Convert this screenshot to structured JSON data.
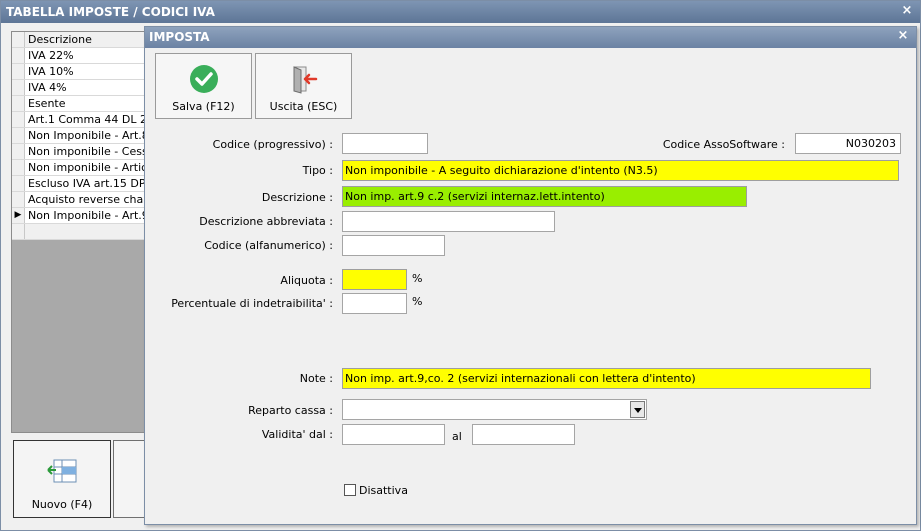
{
  "outer": {
    "title": "TABELLA IMPOSTE / CODICI IVA",
    "close_label": "×",
    "grid": {
      "header": "Descrizione",
      "rows": [
        "IVA 22%",
        "IVA 10%",
        "IVA 4%",
        "Esente",
        "Art.1 Comma 44 DL 27/1",
        "Non Imponibile - Art.8 Co",
        "Non imponibile - Cessioni",
        "Non imponibile - Articolo",
        "Escluso IVA art.15 DPR 6",
        "Acquisto reverse charge",
        "Non Imponibile - Art.9 Co"
      ],
      "current_row_marker": "▶"
    },
    "new_button": "Nuovo (F4)"
  },
  "dialog": {
    "title": "IMPOSTA",
    "close_label": "×",
    "save_button": "Salva (F12)",
    "exit_button": "Uscita (ESC)",
    "labels": {
      "codice_progressivo": "Codice (progressivo) :",
      "codice_assosoftware": "Codice AssoSoftware :",
      "tipo": "Tipo :",
      "descrizione": "Descrizione :",
      "descrizione_abbreviata": "Descrizione abbreviata :",
      "codice_alfanumerico": "Codice (alfanumerico) :",
      "aliquota": "Aliquota :",
      "percentuale_indetraibilita": "Percentuale di indetraibilita' :",
      "note": "Note :",
      "reparto_cassa": "Reparto cassa :",
      "validita_dal": "Validita' dal :",
      "al": "al",
      "disattiva": "Disattiva",
      "percent": "%"
    },
    "values": {
      "codice_progressivo": "",
      "codice_assosoftware": "N030203",
      "tipo": "Non imponibile - A seguito dichiarazione d'intento (N3.5)",
      "descrizione": "Non imp. art.9 c.2 (servizi internaz.lett.intento)",
      "descrizione_abbreviata": "",
      "codice_alfanumerico": "",
      "aliquota": "",
      "percentuale_indetraibilita": "",
      "note": "Non imp. art.9,co. 2 (servizi internazionali con lettera d'intento)",
      "reparto_cassa": "",
      "validita_dal": "",
      "validita_al": ""
    }
  },
  "colors": {
    "title_bar": "#6b82a3",
    "required_field": "#ffff00",
    "description_field": "#99ee00",
    "save_icon": "#3aae5a",
    "exit_icon_arrow": "#e03a2a"
  }
}
